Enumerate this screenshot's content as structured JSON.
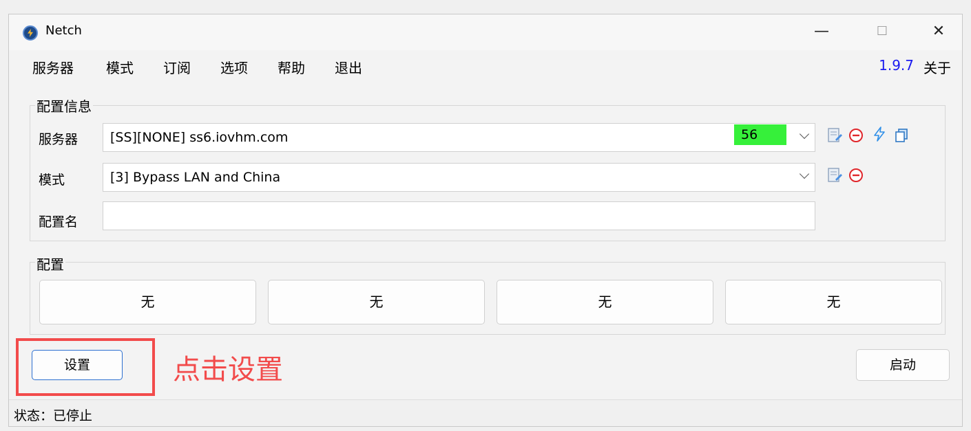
{
  "window": {
    "title": "Netch",
    "minimize_glyph": "—",
    "maximize_glyph": "☐",
    "close_glyph": "✕"
  },
  "menubar": {
    "items": [
      "服务器",
      "模式",
      "订阅",
      "选项",
      "帮助",
      "退出"
    ],
    "version": "1.9.7",
    "about_label": "关于"
  },
  "config_info": {
    "group_label": "配置信息",
    "server_label": "服务器",
    "server_value": "[SS][NONE] ss6.iovhm.com",
    "latency": "56",
    "latency_color": "#36f03a",
    "mode_label": "模式",
    "mode_value": "[3] Bypass LAN and China",
    "profile_name_label": "配置名",
    "profile_name_value": "",
    "server_icons": [
      "edit-icon",
      "remove-icon",
      "speedtest-icon",
      "copy-icon"
    ],
    "mode_icons": [
      "edit-icon",
      "remove-icon"
    ]
  },
  "profiles": {
    "group_label": "配置",
    "buttons": [
      "无",
      "无",
      "无",
      "无"
    ]
  },
  "actions": {
    "settings_label": "设置",
    "start_label": "启动"
  },
  "annotation": {
    "text": "点击设置",
    "color": "#f24b4b"
  },
  "status": {
    "text": "状态：已停止"
  }
}
